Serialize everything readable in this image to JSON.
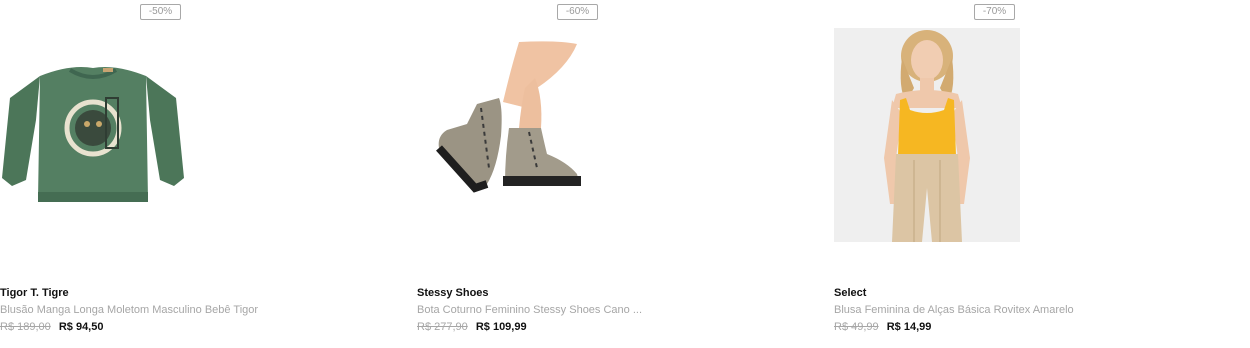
{
  "products": [
    {
      "discount": "-50%",
      "brand": "Tigor T. Tigre",
      "description": "Blusão Manga Longa Moletom Masculino Bebê Tigor",
      "old_price": "R$ 189,00",
      "new_price": "R$ 94,50",
      "image_icon": "green-sweatshirt-image"
    },
    {
      "discount": "-60%",
      "brand": "Stessy Shoes",
      "description": "Bota Coturno Feminino Stessy Shoes Cano ...",
      "old_price": "R$ 277,90",
      "new_price": "R$ 109,99",
      "image_icon": "metallic-boots-image"
    },
    {
      "discount": "-70%",
      "brand": "Select",
      "description": "Blusa Feminina de Alças Básica Rovitex Amarelo",
      "old_price": "R$ 49,99",
      "new_price": "R$ 14,99",
      "image_icon": "yellow-tank-top-model-image"
    }
  ],
  "colors": {
    "sweatshirt": "#4f7a5e",
    "boots": "#9a9282",
    "tank_top": "#f5b820",
    "pants": "#dcc6a6"
  }
}
